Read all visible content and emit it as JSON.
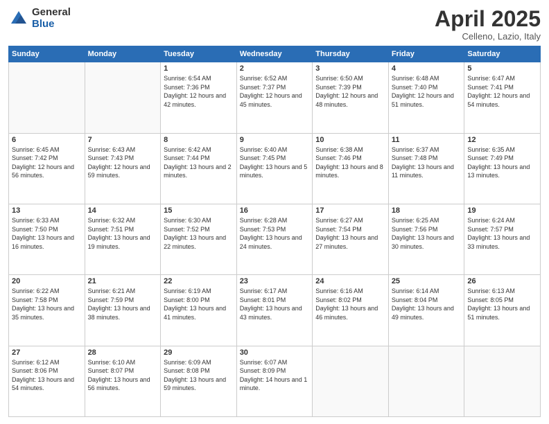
{
  "logo": {
    "general": "General",
    "blue": "Blue"
  },
  "header": {
    "month": "April 2025",
    "location": "Celleno, Lazio, Italy"
  },
  "weekdays": [
    "Sunday",
    "Monday",
    "Tuesday",
    "Wednesday",
    "Thursday",
    "Friday",
    "Saturday"
  ],
  "weeks": [
    [
      {
        "day": "",
        "info": ""
      },
      {
        "day": "",
        "info": ""
      },
      {
        "day": "1",
        "info": "Sunrise: 6:54 AM\nSunset: 7:36 PM\nDaylight: 12 hours and 42 minutes."
      },
      {
        "day": "2",
        "info": "Sunrise: 6:52 AM\nSunset: 7:37 PM\nDaylight: 12 hours and 45 minutes."
      },
      {
        "day": "3",
        "info": "Sunrise: 6:50 AM\nSunset: 7:39 PM\nDaylight: 12 hours and 48 minutes."
      },
      {
        "day": "4",
        "info": "Sunrise: 6:48 AM\nSunset: 7:40 PM\nDaylight: 12 hours and 51 minutes."
      },
      {
        "day": "5",
        "info": "Sunrise: 6:47 AM\nSunset: 7:41 PM\nDaylight: 12 hours and 54 minutes."
      }
    ],
    [
      {
        "day": "6",
        "info": "Sunrise: 6:45 AM\nSunset: 7:42 PM\nDaylight: 12 hours and 56 minutes."
      },
      {
        "day": "7",
        "info": "Sunrise: 6:43 AM\nSunset: 7:43 PM\nDaylight: 12 hours and 59 minutes."
      },
      {
        "day": "8",
        "info": "Sunrise: 6:42 AM\nSunset: 7:44 PM\nDaylight: 13 hours and 2 minutes."
      },
      {
        "day": "9",
        "info": "Sunrise: 6:40 AM\nSunset: 7:45 PM\nDaylight: 13 hours and 5 minutes."
      },
      {
        "day": "10",
        "info": "Sunrise: 6:38 AM\nSunset: 7:46 PM\nDaylight: 13 hours and 8 minutes."
      },
      {
        "day": "11",
        "info": "Sunrise: 6:37 AM\nSunset: 7:48 PM\nDaylight: 13 hours and 11 minutes."
      },
      {
        "day": "12",
        "info": "Sunrise: 6:35 AM\nSunset: 7:49 PM\nDaylight: 13 hours and 13 minutes."
      }
    ],
    [
      {
        "day": "13",
        "info": "Sunrise: 6:33 AM\nSunset: 7:50 PM\nDaylight: 13 hours and 16 minutes."
      },
      {
        "day": "14",
        "info": "Sunrise: 6:32 AM\nSunset: 7:51 PM\nDaylight: 13 hours and 19 minutes."
      },
      {
        "day": "15",
        "info": "Sunrise: 6:30 AM\nSunset: 7:52 PM\nDaylight: 13 hours and 22 minutes."
      },
      {
        "day": "16",
        "info": "Sunrise: 6:28 AM\nSunset: 7:53 PM\nDaylight: 13 hours and 24 minutes."
      },
      {
        "day": "17",
        "info": "Sunrise: 6:27 AM\nSunset: 7:54 PM\nDaylight: 13 hours and 27 minutes."
      },
      {
        "day": "18",
        "info": "Sunrise: 6:25 AM\nSunset: 7:56 PM\nDaylight: 13 hours and 30 minutes."
      },
      {
        "day": "19",
        "info": "Sunrise: 6:24 AM\nSunset: 7:57 PM\nDaylight: 13 hours and 33 minutes."
      }
    ],
    [
      {
        "day": "20",
        "info": "Sunrise: 6:22 AM\nSunset: 7:58 PM\nDaylight: 13 hours and 35 minutes."
      },
      {
        "day": "21",
        "info": "Sunrise: 6:21 AM\nSunset: 7:59 PM\nDaylight: 13 hours and 38 minutes."
      },
      {
        "day": "22",
        "info": "Sunrise: 6:19 AM\nSunset: 8:00 PM\nDaylight: 13 hours and 41 minutes."
      },
      {
        "day": "23",
        "info": "Sunrise: 6:17 AM\nSunset: 8:01 PM\nDaylight: 13 hours and 43 minutes."
      },
      {
        "day": "24",
        "info": "Sunrise: 6:16 AM\nSunset: 8:02 PM\nDaylight: 13 hours and 46 minutes."
      },
      {
        "day": "25",
        "info": "Sunrise: 6:14 AM\nSunset: 8:04 PM\nDaylight: 13 hours and 49 minutes."
      },
      {
        "day": "26",
        "info": "Sunrise: 6:13 AM\nSunset: 8:05 PM\nDaylight: 13 hours and 51 minutes."
      }
    ],
    [
      {
        "day": "27",
        "info": "Sunrise: 6:12 AM\nSunset: 8:06 PM\nDaylight: 13 hours and 54 minutes."
      },
      {
        "day": "28",
        "info": "Sunrise: 6:10 AM\nSunset: 8:07 PM\nDaylight: 13 hours and 56 minutes."
      },
      {
        "day": "29",
        "info": "Sunrise: 6:09 AM\nSunset: 8:08 PM\nDaylight: 13 hours and 59 minutes."
      },
      {
        "day": "30",
        "info": "Sunrise: 6:07 AM\nSunset: 8:09 PM\nDaylight: 14 hours and 1 minute."
      },
      {
        "day": "",
        "info": ""
      },
      {
        "day": "",
        "info": ""
      },
      {
        "day": "",
        "info": ""
      }
    ]
  ]
}
